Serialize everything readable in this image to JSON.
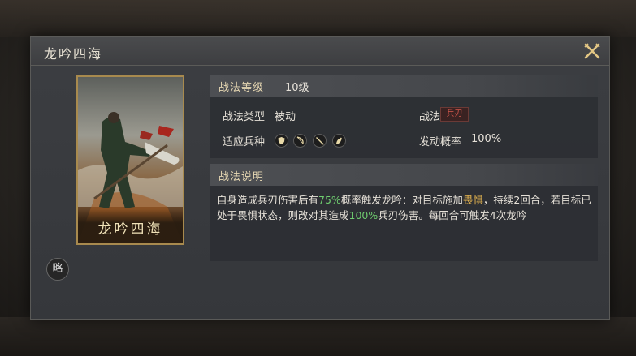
{
  "dialog": {
    "title": "龙吟四海"
  },
  "card": {
    "name": "龙吟四海"
  },
  "side_button": "略",
  "level": {
    "label": "战法等级",
    "value": "10级"
  },
  "attributes": {
    "type_label": "战法类型",
    "type_value": "被动",
    "trait_label": "战法特性",
    "trait_value": "兵刃",
    "troops_label": "适应兵种",
    "troops": [
      "shield-troop-icon",
      "bow-troop-icon",
      "spear-troop-icon",
      "cavalry-troop-icon"
    ],
    "rate_label": "发动概率",
    "rate_value": "100%"
  },
  "description": {
    "header": "战法说明",
    "seg1": "自身造成兵刃伤害后有",
    "seg2": "75%",
    "seg3": "概率触发龙吟：对目标施加",
    "seg4": "畏惧",
    "seg5": "，持续2回合，若目标已处于畏惧状态，则改对其造成",
    "seg6": "100%",
    "seg7": "兵刃伤害。每回合可触发4次龙吟"
  },
  "colors": {
    "highlight_green": "#6fcc6f",
    "highlight_gold": "#e3b34f",
    "trait_red": "#d5584d",
    "frame_gold": "#a88a4e"
  }
}
